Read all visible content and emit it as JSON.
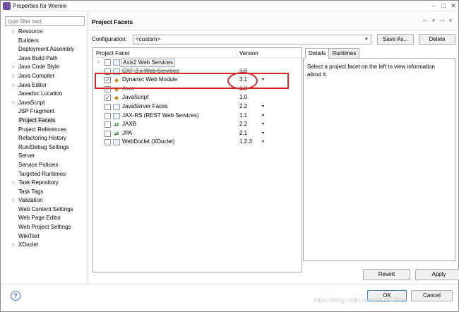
{
  "window": {
    "title": "Properties for Wxmini",
    "min": "–",
    "max": "□",
    "close": "✕"
  },
  "sidebar": {
    "filter_placeholder": "type filter text",
    "items": [
      {
        "label": "Resource",
        "expandable": true
      },
      {
        "label": "Builders",
        "expandable": false
      },
      {
        "label": "Deployment Assembly",
        "expandable": false
      },
      {
        "label": "Java Build Path",
        "expandable": false
      },
      {
        "label": "Java Code Style",
        "expandable": true
      },
      {
        "label": "Java Compiler",
        "expandable": true
      },
      {
        "label": "Java Editor",
        "expandable": true
      },
      {
        "label": "Javadoc Location",
        "expandable": false
      },
      {
        "label": "JavaScript",
        "expandable": true
      },
      {
        "label": "JSP Fragment",
        "expandable": false
      },
      {
        "label": "Project Facets",
        "expandable": false
      },
      {
        "label": "Project References",
        "expandable": false
      },
      {
        "label": "Refactoring History",
        "expandable": false
      },
      {
        "label": "Run/Debug Settings",
        "expandable": false
      },
      {
        "label": "Server",
        "expandable": false
      },
      {
        "label": "Service Policies",
        "expandable": false
      },
      {
        "label": "Targeted Runtimes",
        "expandable": false
      },
      {
        "label": "Task Repository",
        "expandable": true
      },
      {
        "label": "Task Tags",
        "expandable": false
      },
      {
        "label": "Validation",
        "expandable": true
      },
      {
        "label": "Web Content Settings",
        "expandable": false
      },
      {
        "label": "Web Page Editor",
        "expandable": false
      },
      {
        "label": "Web Project Settings",
        "expandable": false
      },
      {
        "label": "WikiText",
        "expandable": false
      },
      {
        "label": "XDoclet",
        "expandable": true
      }
    ]
  },
  "header": {
    "title": "Project Facets",
    "back": "⇦",
    "back_menu": "▾",
    "forward": "⇨",
    "forward_menu": "▾"
  },
  "configuration": {
    "label": "Configuration:",
    "value": "<custom>",
    "save_as": "Save As...",
    "delete": "Delete"
  },
  "facets": {
    "col_facet": "Project Facet",
    "col_version": "Version",
    "rows": [
      {
        "name": "Axis2 Web Services",
        "version": "",
        "checked": false,
        "icon": "page",
        "expander": "▷"
      },
      {
        "name": "CXF 2.x Web Services",
        "version": "1.0",
        "checked": false,
        "icon": "page",
        "expander": "",
        "strike": true
      },
      {
        "name": "Dynamic Web Module",
        "version": "3.1",
        "checked": true,
        "icon": "jar",
        "dropdown": "▾"
      },
      {
        "name": "Java",
        "version": "1.8",
        "checked": true,
        "icon": "jar",
        "strike": true
      },
      {
        "name": "JavaScript",
        "version": "1.0",
        "checked": true,
        "icon": "jar"
      },
      {
        "name": "JavaServer Faces",
        "version": "2.2",
        "checked": false,
        "icon": "page",
        "dropdown": "▾"
      },
      {
        "name": "JAX-RS (REST Web Services)",
        "version": "1.1",
        "checked": false,
        "icon": "page",
        "dropdown": "▾"
      },
      {
        "name": "JAXB",
        "version": "2.2",
        "checked": false,
        "icon": "arrows",
        "dropdown": "▾"
      },
      {
        "name": "JPA",
        "version": "2.1",
        "checked": false,
        "icon": "arrows",
        "dropdown": "▾"
      },
      {
        "name": "WebDoclet (XDoclet)",
        "version": "1.2.3",
        "checked": false,
        "icon": "page",
        "dropdown": "▾"
      }
    ]
  },
  "details": {
    "tab_details": "Details",
    "tab_runtimes": "Runtimes",
    "text": "Select a project facet on the left to view information about it."
  },
  "actions": {
    "revert": "Revert",
    "apply": "Apply",
    "ok": "OK",
    "cancel": "Cancel",
    "help": "?"
  },
  "watermark": "https://blog.csdn.net/u013343016",
  "colors": {
    "highlight": "#d42a2a",
    "selection": "#e5e5e5"
  }
}
